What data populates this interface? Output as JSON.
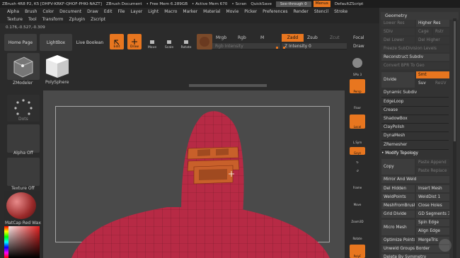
{
  "titlebar": {
    "title": "ZBrush 4R8 P2, K5 [DHPV-KRKF-QHOF-PHKI-NAZT]",
    "doc": "ZBrush Document",
    "free_mem": "• Free Mem 6.289GB",
    "active_mem": "• Active Mem 670",
    "scratch": "• Scran",
    "quicksave": "QuickSave",
    "see_through": "See-through  0",
    "menus": "Menus",
    "zscript": "DefaultZScript"
  },
  "menubar": {
    "row1": [
      "Alpha",
      "Brush",
      "Color",
      "Document",
      "Draw",
      "Edit",
      "File",
      "Layer",
      "Light",
      "Macro",
      "Marker",
      "Material",
      "Movie",
      "Picker",
      "Preferences",
      "Render",
      "Stencil",
      "Stroke"
    ],
    "row2": [
      "Texture",
      "Tool",
      "Transform",
      "Zplugin",
      "Zscript"
    ]
  },
  "coords": "0.176,-0.527,-0.309",
  "toolbar": {
    "home_page": "Home Page",
    "lightbox": "LightBox",
    "live_boolean": "Live Boolean",
    "edit": "Edit",
    "draw": "Draw",
    "move": "Move",
    "scale": "Scale",
    "rotate": "Rotate",
    "mrgb": "Mrgb",
    "rgb": "Rgb",
    "m": "M",
    "zadd": "Zadd",
    "zsub": "Zsub",
    "zcut": "Zcut",
    "rgb_intensity": "Rgb Intensity",
    "z_intensity": "Z Intensity 0",
    "focal": "Focal",
    "draw_size": "Draw"
  },
  "left": {
    "zmodeler_label": "ZModeler",
    "polysphere_label": "PolySphere",
    "dots_label": "Dots",
    "alpha_label": "Alpha Off",
    "texture_label": "Texture Off",
    "matcap_label": "MatCap Red Wax"
  },
  "right_strip": {
    "spix": "SPix 3",
    "persp": "Persp",
    "floor": "Floor",
    "local": "Local",
    "lsym": "L.Sym",
    "xyz": "Gxyz",
    "frame": "Frame",
    "move": "Move",
    "zoom3d": "Zoom3D",
    "rotate": "Rotate",
    "polyf": "PolyF"
  },
  "panel": {
    "header": "Geometry",
    "lower_res": "Lower Res",
    "higher_res": "Higher Res",
    "sdiv": "SDiv",
    "cage": "Cage",
    "rstr": "Rstr",
    "del_lower": "Del Lower",
    "del_higher": "Del Higher",
    "freeze_subdiv": "Freeze SubDivision Levels",
    "reconstruct_subdiv": "Reconstruct Subdiv",
    "convert_bpr": "Convert BPR To Geo",
    "divide": "Divide",
    "smt": "Smt",
    "suv": "Suv",
    "reuv": "ReUV",
    "dynamic_subdiv": "Dynamic Subdiv",
    "edgeloop": "EdgeLoop",
    "crease": "Crease",
    "shadowbox": "ShadowBox",
    "claypolish": "ClayPolish",
    "dynamesh": "DynaMesh",
    "zremesher": "ZRemesher",
    "modify_topology": "• Modify Topology",
    "copy": "Copy",
    "paste_append": "Paste Append",
    "paste_replace": "Paste Replace",
    "mirror_and_weld": "Mirror And Weld",
    "del_hidden": "Del Hidden",
    "insert_mesh": "Insert Mesh",
    "weldpoints": "WeldPoints",
    "welddist": "WeldDist 1",
    "meshfrombrush": "MeshFromBrush",
    "close_holes": "Close Holes",
    "grid_divide": "Grid Divide",
    "gd_segments": "GD Segments 3",
    "micro_mesh": "Micro Mesh",
    "spin_edge": "Spin Edge",
    "align_edge": "Align Edge",
    "optimize_points": "Optimize Points",
    "mergetris": "MergeTris",
    "unweld_groups_border": "Unweld Groups Border",
    "delete_by_symmetry": "Delete By Symmetry"
  },
  "colors": {
    "accent": "#e8761f",
    "model": "#b72a45",
    "viewport": "#4a4a4a"
  }
}
